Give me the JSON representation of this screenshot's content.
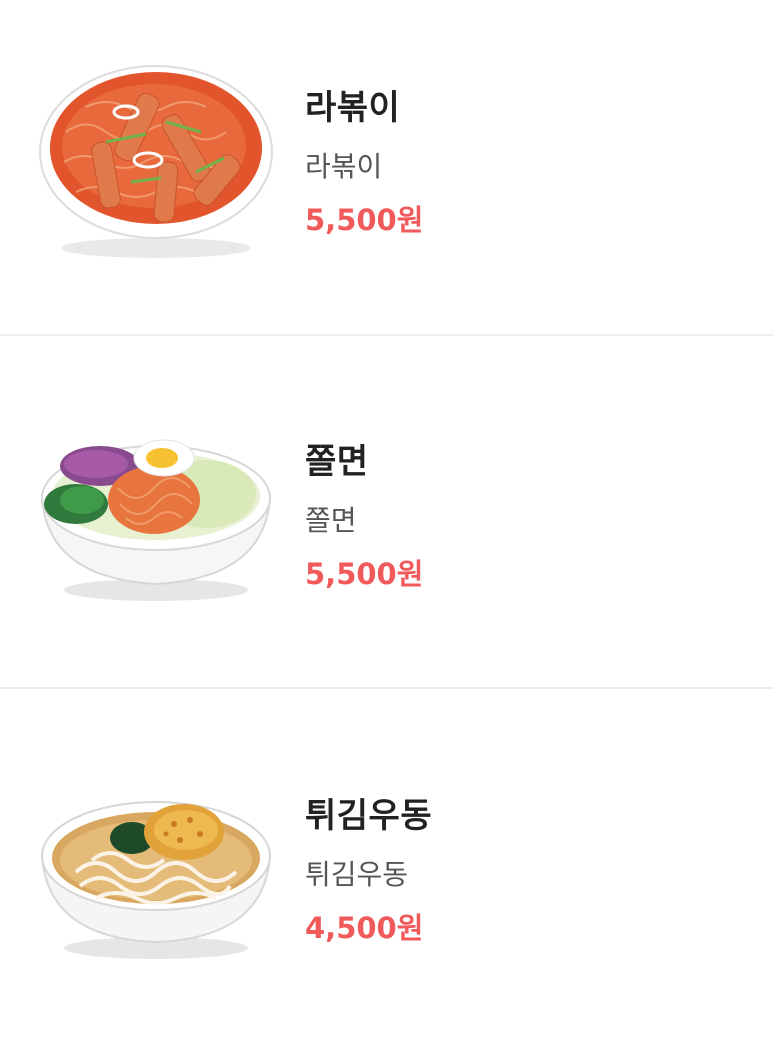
{
  "menu": {
    "items": [
      {
        "image": "rabokki-bowl-photo",
        "name": "라볶이",
        "description": "라볶이",
        "price": "5,500원"
      },
      {
        "image": "jjolmyeon-bowl-photo",
        "name": "쫄면",
        "description": "쫄면",
        "price": "5,500원"
      },
      {
        "image": "tempura-udon-bowl-photo",
        "name": "튀김우동",
        "description": "튀김우동",
        "price": "4,500원"
      }
    ]
  },
  "colors": {
    "price": "#f05a5a",
    "name": "#222222",
    "description": "#555555",
    "divider": "#ececec"
  }
}
